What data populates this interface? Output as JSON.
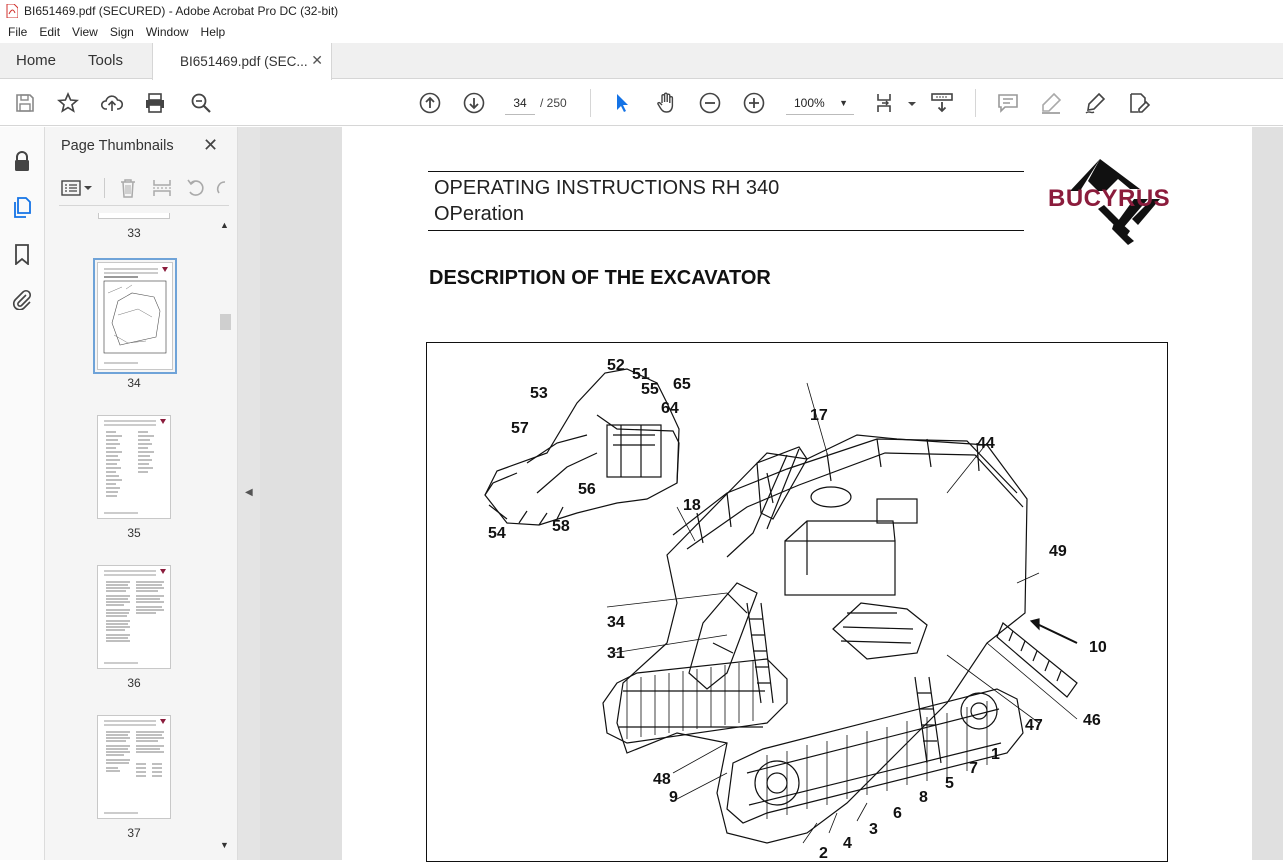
{
  "window": {
    "title": "BI651469.pdf (SECURED) - Adobe Acrobat Pro DC (32-bit)"
  },
  "menu": {
    "items": [
      "File",
      "Edit",
      "View",
      "Sign",
      "Window",
      "Help"
    ]
  },
  "tabs": {
    "home": "Home",
    "tools": "Tools",
    "document": "BI651469.pdf (SEC..."
  },
  "toolbar": {
    "current_page": "34",
    "total_pages": "/ 250",
    "zoom": "100%"
  },
  "thumbnails": {
    "title": "Page Thumbnails",
    "pages": [
      "33",
      "34",
      "35",
      "36",
      "37"
    ],
    "selected": "34"
  },
  "document": {
    "header_line1": "OPERATING INSTRUCTIONS RH 340",
    "header_line2": "OPeration",
    "logo_text": "BUCYRUS",
    "section_title": "DESCRIPTION OF THE EXCAVATOR",
    "callouts": [
      "52",
      "51",
      "55",
      "65",
      "53",
      "64",
      "57",
      "56",
      "54",
      "58",
      "17",
      "44",
      "18",
      "49",
      "34",
      "10",
      "31",
      "47",
      "46",
      "1",
      "48",
      "7",
      "9",
      "5",
      "8",
      "6",
      "3",
      "4",
      "2"
    ]
  },
  "colors": {
    "accent": "#1473e6",
    "logo": "#8b1c3c",
    "selection": "#6fa3d8"
  }
}
